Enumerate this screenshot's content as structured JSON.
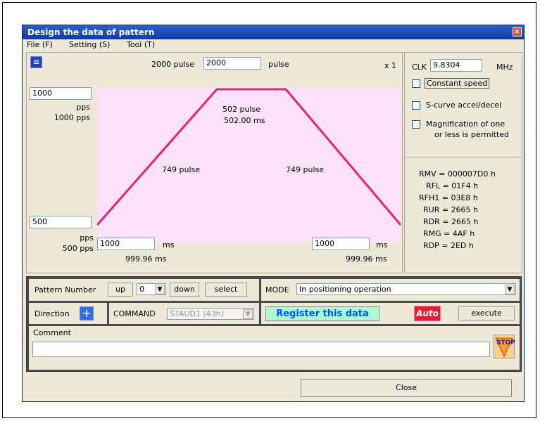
{
  "window": {
    "title": "Design the data of pattern",
    "close_glyph": "×"
  },
  "menu": [
    {
      "label": "File (F)"
    },
    {
      "label": "Setting (S)"
    },
    {
      "label": "Tool (T)"
    }
  ],
  "graph": {
    "total_pulse_label": "2000 pulse",
    "total_pulse_value": "2000",
    "pulse_unit": "pulse",
    "scale": "x 1",
    "max_speed_value": "1000",
    "pps_unit": "pps",
    "max_speed_readout": "1000 pps",
    "flat_pulse": "502 pulse",
    "flat_time": "502.00 ms",
    "accel_pulse": "749 pulse",
    "decel_pulse": "749 pulse",
    "start_speed_value": "500",
    "start_speed_readout": "500 pps",
    "accel_time_value": "1000",
    "ms_unit": "ms",
    "accel_time_readout": "999.96 ms",
    "decel_time_value": "1000",
    "decel_time_readout": "999.96 ms",
    "line_color": "#e8207a",
    "bg_color": "#fbe2f8"
  },
  "settings": {
    "clk_label": "CLK",
    "clk_value": "9.8304",
    "clk_unit": "MHz",
    "constant_speed": "Constant speed",
    "s_curve": "S-curve accel/decel",
    "magnification_line1": "Magnification of one",
    "magnification_line2": "or less is permitted"
  },
  "registers": [
    {
      "label": "RMV = 000007D0 h"
    },
    {
      "label": "RFL = 01F4 h"
    },
    {
      "label": "RFH1 = 03E8 h"
    },
    {
      "label": "RUR = 2665 h"
    },
    {
      "label": "RDR = 2665 h"
    },
    {
      "label": "RMG = 4AF h"
    },
    {
      "label": "RDP = 2ED h"
    }
  ],
  "controls": {
    "pattern_number_label": "Pattern Number",
    "up_label": "up",
    "pattern_number_value": "0",
    "down_label": "down",
    "select_label": "select",
    "mode_label": "MODE",
    "mode_value": "In positioning operation",
    "direction_label": "Direction",
    "command_label": "COMMAND",
    "command_value": "STAUD1 (43h)",
    "register_label": "Register this data",
    "auto_label": "Auto",
    "execute_label": "execute",
    "comment_label": "Comment",
    "comment_value": "",
    "stop_label": "STOP"
  },
  "footer": {
    "close_label": "Close"
  }
}
